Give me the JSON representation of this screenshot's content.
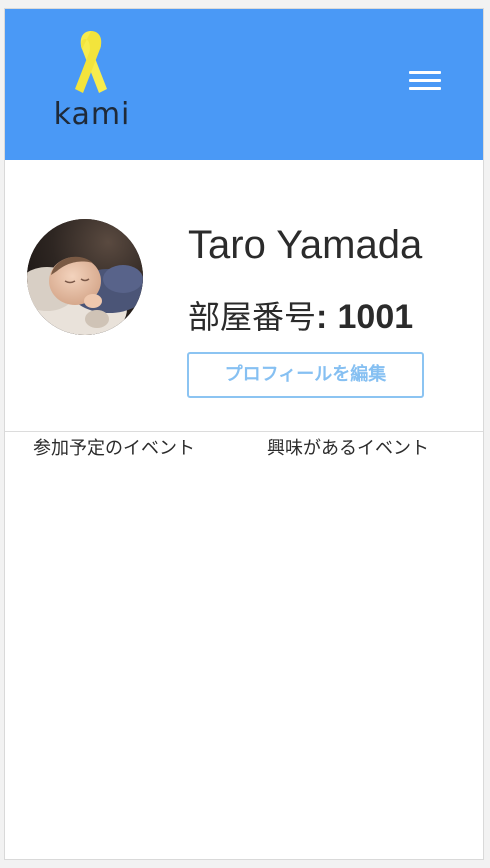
{
  "header": {
    "logo_text": "kami",
    "ribbon_color": "#f7ec4e",
    "background_color": "#4a99f6",
    "menu_icon": "hamburger-menu-icon"
  },
  "profile": {
    "name": "Taro Yamada",
    "room_label": "部屋番号",
    "room_separator": ":",
    "room_number": "1001",
    "edit_button_label": "プロフィールを編集",
    "avatar_description_icon": "sleeping-baby-avatar"
  },
  "tabs": [
    {
      "label": "参加予定のイベント"
    },
    {
      "label": "興味があるイベント"
    }
  ],
  "colors": {
    "accent_light_blue": "#8cc4f2",
    "text_dark": "#2b2b2b"
  }
}
